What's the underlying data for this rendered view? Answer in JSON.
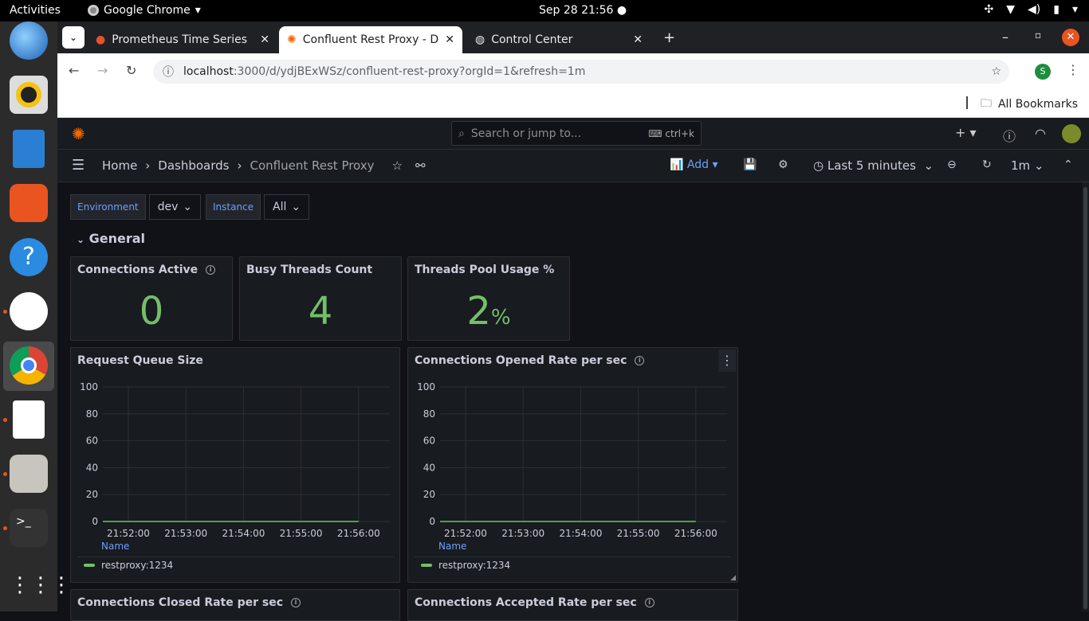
{
  "os": {
    "activities": "Activities",
    "app_name": "Google Chrome",
    "clock": "Sep 28  21:56"
  },
  "browser": {
    "tabs": [
      {
        "label": "Prometheus Time Series"
      },
      {
        "label": "Confluent Rest Proxy - D"
      },
      {
        "label": "Control Center"
      }
    ],
    "url_host": "localhost",
    "url_rest": ":3000/d/ydjBExWSz/confluent-rest-proxy?orgId=1&refresh=1m",
    "profile_initial": "S",
    "all_bookmarks": "All Bookmarks"
  },
  "grafana": {
    "search_placeholder": "Search or jump to...",
    "search_shortcut": "ctrl+k",
    "breadcrumb": {
      "home": "Home",
      "dashboards": "Dashboards",
      "current": "Confluent Rest Proxy"
    },
    "add_label": "Add",
    "time_range": "Last 5 minutes",
    "refresh_interval": "1m",
    "variables": [
      {
        "label": "Environment",
        "value": "dev"
      },
      {
        "label": "Instance",
        "value": "All"
      }
    ],
    "row_title": "General",
    "stats": [
      {
        "title": "Connections Active",
        "value": "0",
        "unit": ""
      },
      {
        "title": "Busy Threads Count",
        "value": "4",
        "unit": ""
      },
      {
        "title": "Threads Pool Usage %",
        "value": "2",
        "unit": "%"
      }
    ],
    "graph_panels": [
      {
        "title": "Request Queue Size"
      },
      {
        "title": "Connections Opened Rate per sec"
      }
    ],
    "bottom_panels": [
      {
        "title": "Connections Closed Rate per sec"
      },
      {
        "title": "Connections Accepted Rate per sec"
      }
    ],
    "legend_header": "Name",
    "accent": "#73bf69",
    "link_color": "#6e9fff"
  },
  "chart_data": [
    {
      "type": "line",
      "title": "Request Queue Size",
      "x_ticks": [
        "21:52:00",
        "21:53:00",
        "21:54:00",
        "21:55:00",
        "21:56:00"
      ],
      "y_ticks": [
        "0",
        "20",
        "40",
        "60",
        "80",
        "100"
      ],
      "ylim": [
        0,
        100
      ],
      "series": [
        {
          "name": "restproxy:1234",
          "x": [
            "21:51:30",
            "21:56:00"
          ],
          "values": [
            0,
            0
          ]
        }
      ]
    },
    {
      "type": "line",
      "title": "Connections Opened Rate per sec",
      "x_ticks": [
        "21:52:00",
        "21:53:00",
        "21:54:00",
        "21:55:00",
        "21:56:00"
      ],
      "y_ticks": [
        "0",
        "20",
        "40",
        "60",
        "80",
        "100"
      ],
      "ylim": [
        0,
        100
      ],
      "series": [
        {
          "name": "restproxy:1234",
          "x": [
            "21:51:30",
            "21:56:00"
          ],
          "values": [
            0,
            0
          ]
        }
      ]
    }
  ]
}
